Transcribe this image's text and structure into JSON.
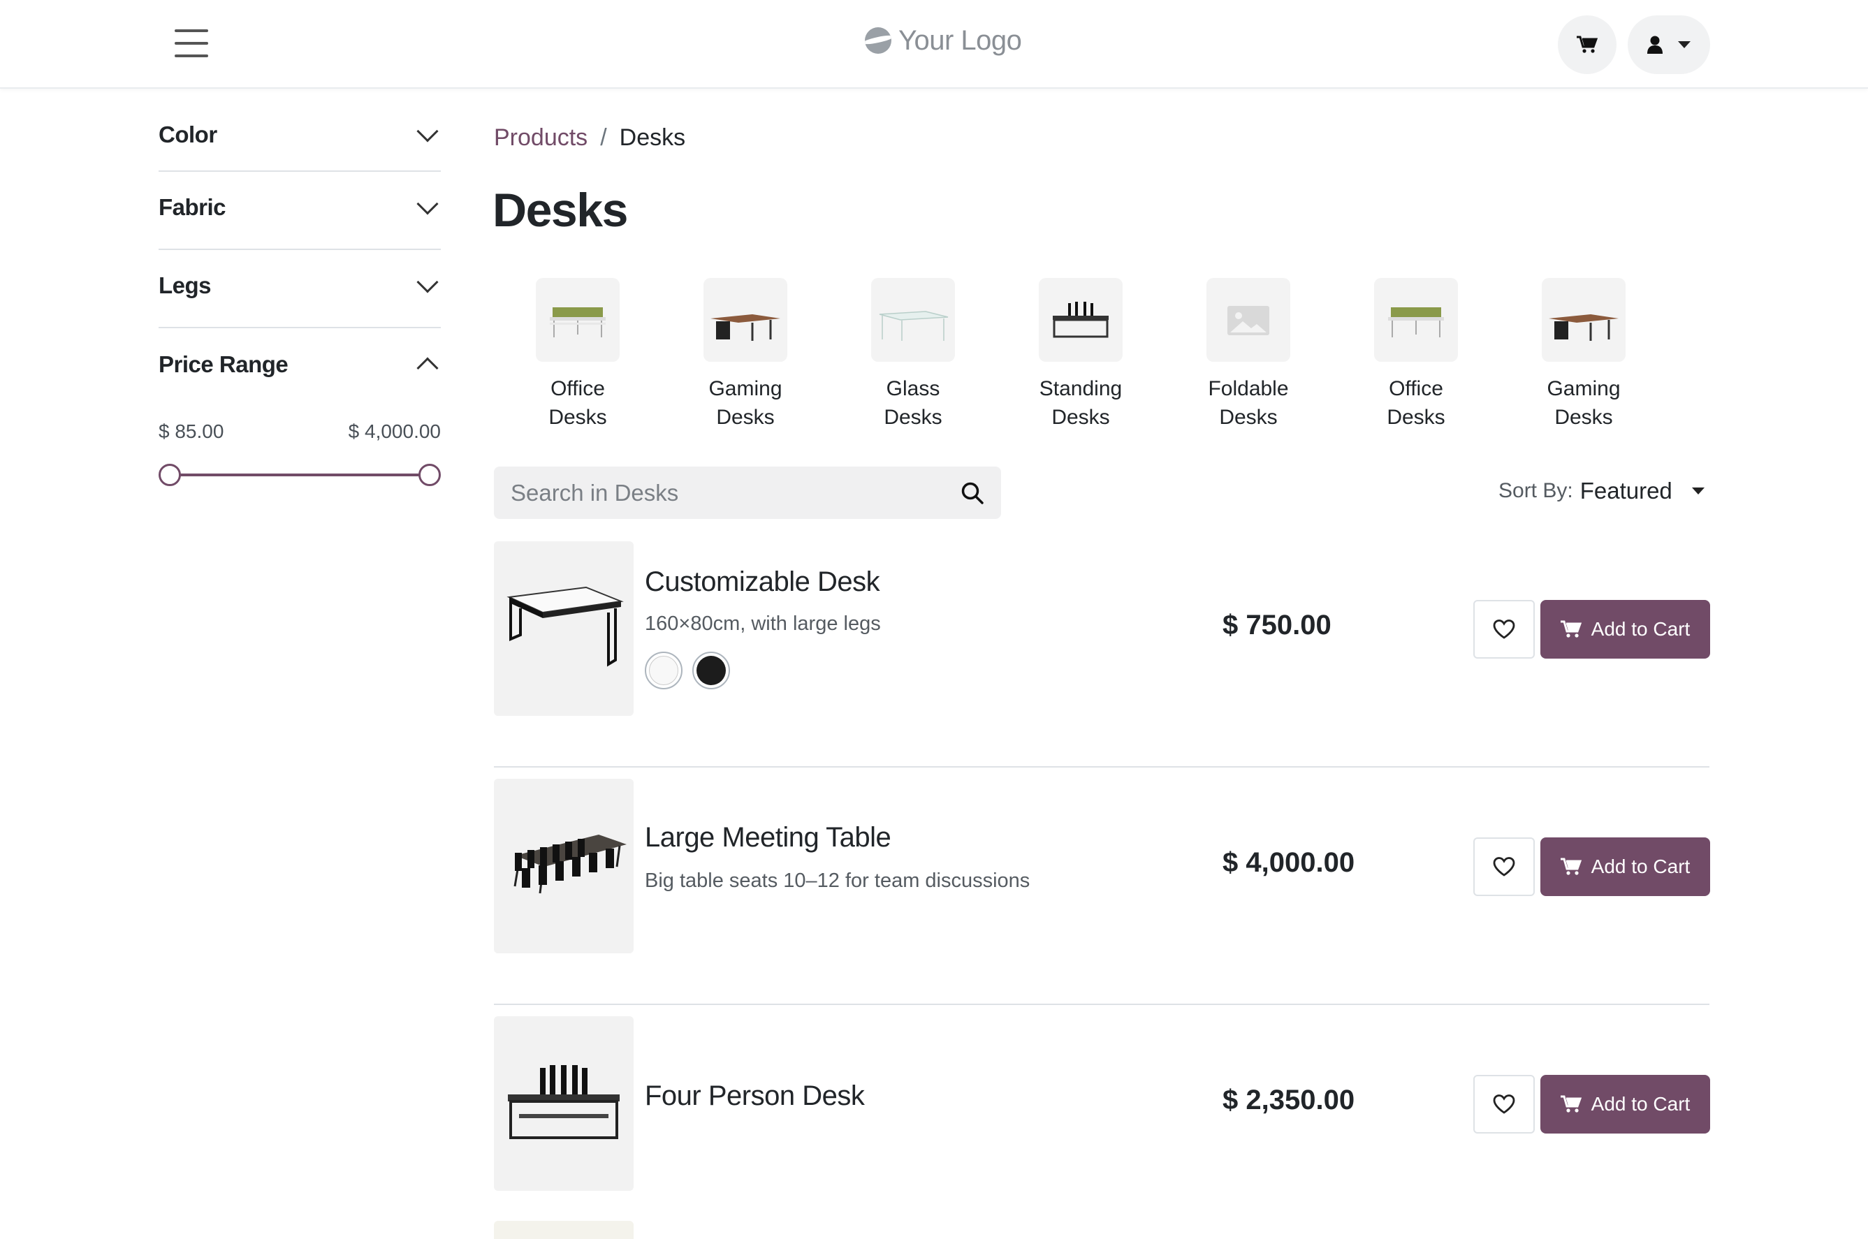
{
  "header": {
    "logo_text": "Your Logo",
    "cart_icon": "cart-icon",
    "user_icon": "user-icon"
  },
  "sidebar": {
    "filters": [
      {
        "label": "Color",
        "expanded": false
      },
      {
        "label": "Fabric",
        "expanded": false
      },
      {
        "label": "Legs",
        "expanded": false
      },
      {
        "label": "Price Range",
        "expanded": true
      }
    ],
    "price_range": {
      "min_label": "$ 85.00",
      "max_label": "$ 4,000.00",
      "min_value": 85,
      "max_value": 4000
    }
  },
  "breadcrumb": {
    "parent": "Products",
    "separator": "/",
    "current": "Desks"
  },
  "page_title": "Desks",
  "categories": [
    {
      "line1": "Office",
      "line2": "Desks"
    },
    {
      "line1": "Gaming",
      "line2": "Desks"
    },
    {
      "line1": "Glass",
      "line2": "Desks"
    },
    {
      "line1": "Standing",
      "line2": "Desks"
    },
    {
      "line1": "Foldable",
      "line2": "Desks"
    },
    {
      "line1": "Office",
      "line2": "Desks"
    },
    {
      "line1": "Gaming",
      "line2": "Desks"
    }
  ],
  "search": {
    "placeholder": "Search in Desks"
  },
  "sort": {
    "label": "Sort By:",
    "value": "Featured"
  },
  "products": [
    {
      "name": "Customizable Desk",
      "description": "160×80cm, with large legs",
      "price": "$ 750.00",
      "cart_label": "Add to Cart",
      "swatches": [
        "#f8f8f8",
        "#1c1c1c"
      ]
    },
    {
      "name": "Large Meeting Table",
      "description": "Big table seats 10–12 for team discussions",
      "price": "$ 4,000.00",
      "cart_label": "Add to Cart"
    },
    {
      "name": "Four Person Desk",
      "description": "",
      "price": "$ 2,350.00",
      "cart_label": "Add to Cart"
    }
  ],
  "colors": {
    "accent": "#714b67",
    "text": "#212529",
    "muted": "#555b61"
  }
}
